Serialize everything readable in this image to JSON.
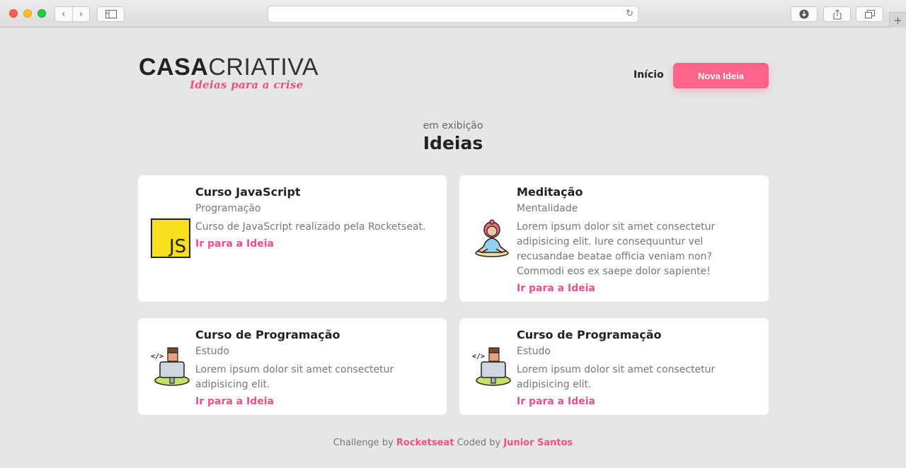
{
  "app": {
    "logo": {
      "bold": "CASA",
      "thin": "CRIATIVA",
      "tagline": "Ideias para a crise"
    },
    "nav": {
      "home": "Início",
      "new_idea": "Nova Ideia"
    }
  },
  "section": {
    "subtitle": "em exibição",
    "title": "Ideias"
  },
  "ideas": [
    {
      "title": "Curso JavaScript",
      "category": "Programação",
      "description": "Curso de JavaScript realizado pela Rocketseat.",
      "link": "Ir para a Ideia",
      "icon": "javascript-icon"
    },
    {
      "title": "Meditação",
      "category": "Mentalidade",
      "description": "Lorem ipsum dolor sit amet consectetur adipisicing elit. Iure consequuntur vel recusandae beatae officia veniam non? Commodi eos ex saepe dolor sapiente!",
      "link": "Ir para a Ideia",
      "icon": "meditation-icon"
    },
    {
      "title": "Curso de Programação",
      "category": "Estudo",
      "description": "Lorem ipsum dolor sit amet consectetur adipisicing elit.",
      "link": "Ir para a Ideia",
      "icon": "programmer-icon"
    },
    {
      "title": "Curso de Programação",
      "category": "Estudo",
      "description": "Lorem ipsum dolor sit amet consectetur adipisicing elit.",
      "link": "Ir para a Ideia",
      "icon": "programmer-icon"
    }
  ],
  "footer": {
    "prefix": "Challenge by",
    "org": "Rocketseat",
    "middle": "Coded by",
    "author": "Junior Santos"
  },
  "colors": {
    "accent": "#fc6488",
    "link": "#f0507f",
    "background": "#e6e6e6"
  }
}
